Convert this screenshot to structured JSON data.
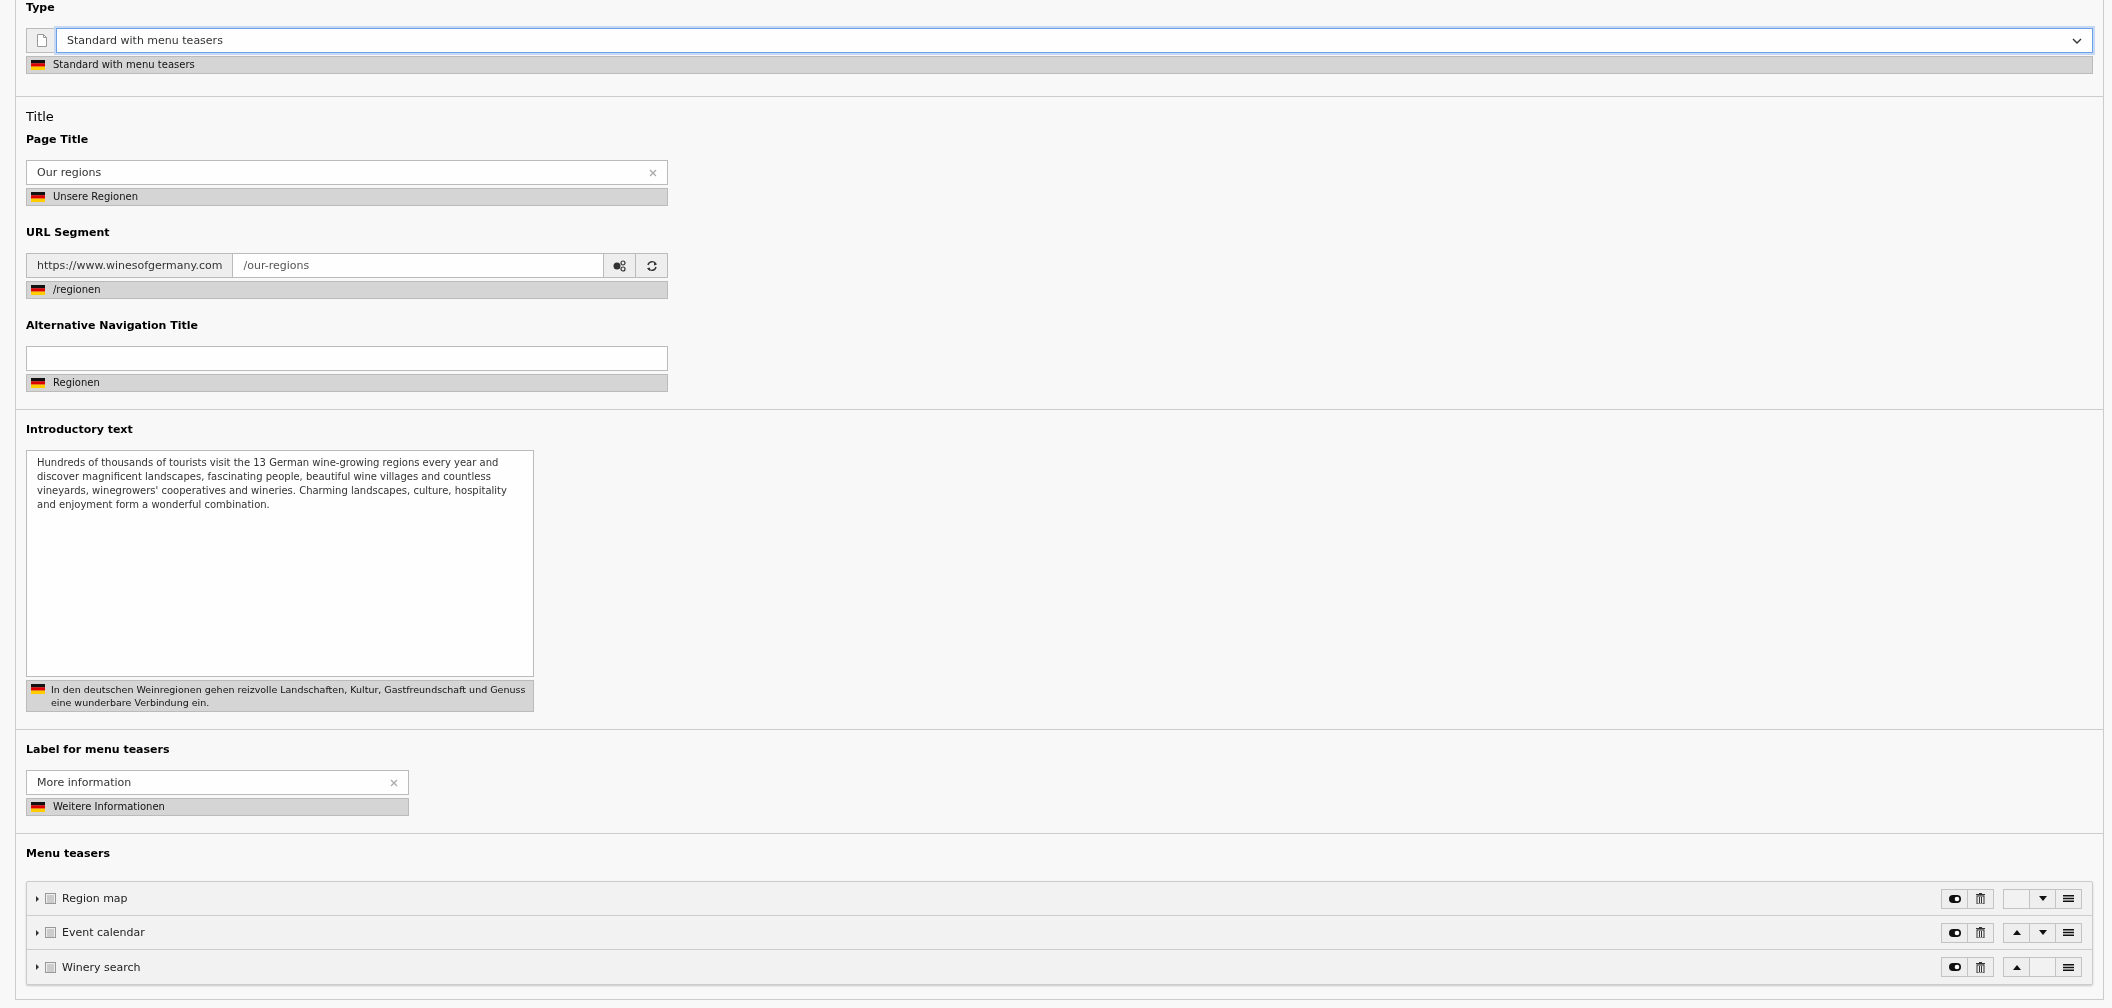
{
  "sections": [
    {
      "fields": [
        {
          "kind": "select",
          "label": "Type",
          "value": "Standard with menu teasers",
          "focused": true,
          "translation": "Standard with menu teasers"
        }
      ]
    },
    {
      "heading": "Title",
      "fields": [
        {
          "kind": "text",
          "label": "Page Title",
          "value": "Our regions",
          "clearable": true,
          "translation": "Unsere Regionen"
        },
        {
          "kind": "slug",
          "label": "URL Segment",
          "prefix": "https://www.winesofgermany.com",
          "value": "/our-regions",
          "translation": "/regionen"
        },
        {
          "kind": "text",
          "label": "Alternative Navigation Title",
          "translation": "Regionen"
        }
      ]
    },
    {
      "fields": [
        {
          "kind": "textarea",
          "label": "Introductory text",
          "value": "Hundreds of thousands of tourists visit the 13 German wine-growing regions every year and discover magnificent landscapes, fascinating people, beautiful wine villages and countless vineyards, winegrowers' cooperatives and wineries. Charming landscapes, culture, hospitality and enjoyment form a wonderful combination.",
          "translation": "In den deutschen Weinregionen gehen reizvolle Landschaften, Kultur, Gastfreundschaft und Genuss eine wunderbare Verbindung ein."
        }
      ]
    },
    {
      "fields": [
        {
          "kind": "short-text",
          "label": "Label for menu teasers",
          "value": "More information",
          "clearable": true,
          "translation": "Weitere Informationen"
        }
      ]
    },
    {
      "fields": [
        {
          "kind": "inline",
          "label": "Menu teasers",
          "items": [
            {
              "title": "Region map",
              "expanded": false,
              "can_move_up": false,
              "can_move_down": true
            },
            {
              "title": "Event calendar",
              "expanded": false,
              "can_move_up": true,
              "can_move_down": true
            },
            {
              "title": "Winery search",
              "expanded": false,
              "can_move_up": true,
              "can_move_down": false
            }
          ]
        }
      ]
    }
  ]
}
